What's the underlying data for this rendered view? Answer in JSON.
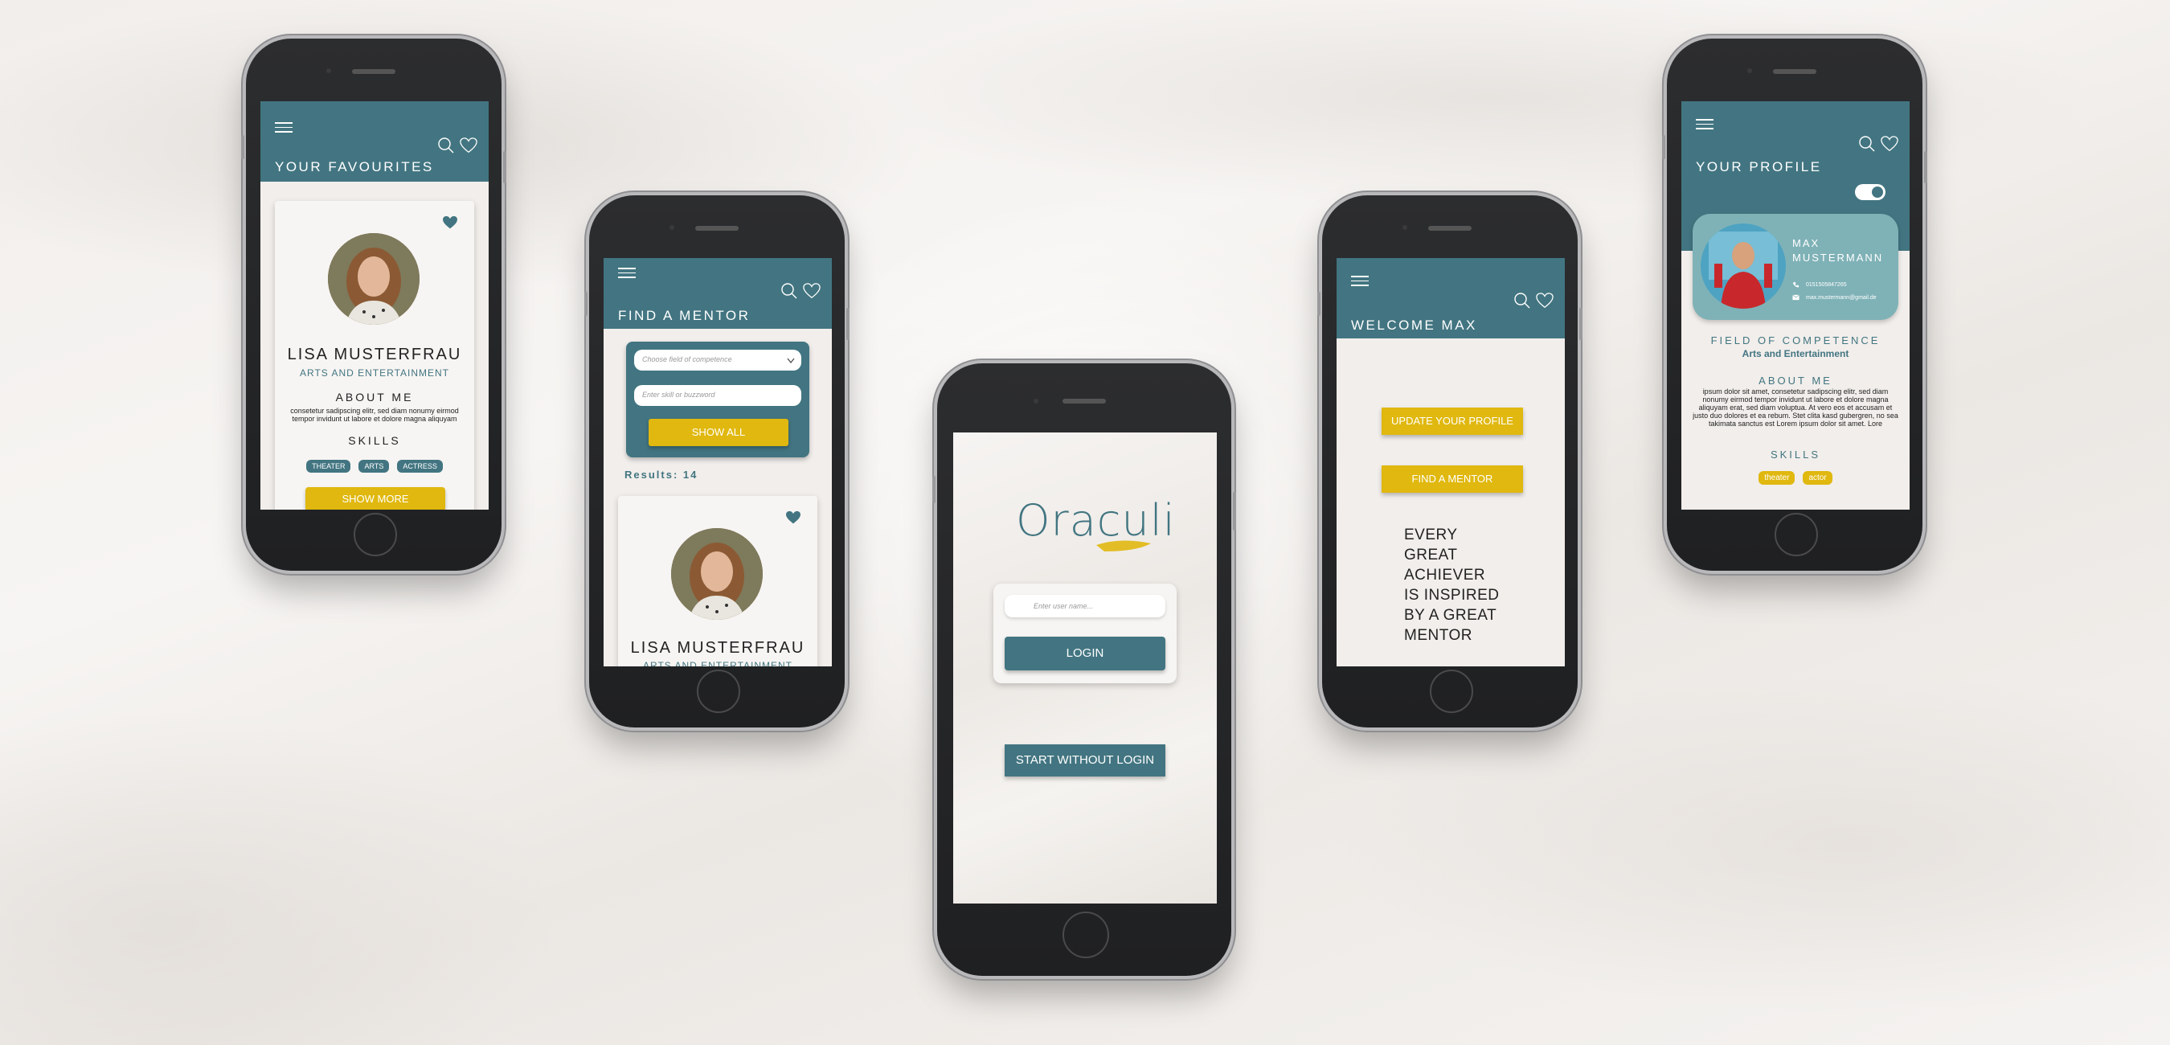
{
  "phone_favourites": {
    "title": "YOUR FAVOURITES",
    "name": "LISA MUSTERFRAU",
    "field": "ARTS AND ENTERTAINMENT",
    "about_heading": "ABOUT ME",
    "about_text": "consetetur sadipscing elitr, sed diam nonumy eirmod tempor invidunt ut labore et dolore magna aliquyam erat, sed diam voluptua. At vero eos et",
    "skills_heading": "SKILLS",
    "skills": [
      "THEATER",
      "ARTS",
      "ACTRESS"
    ],
    "show_more": "SHOW MORE"
  },
  "phone_find_mentor": {
    "title": "FIND A MENTOR",
    "select_placeholder": "Choose field of competence",
    "search_placeholder": "Enter skill or buzzword",
    "show_all": "SHOW ALL",
    "results": "Results: 14",
    "name": "LISA MUSTERFRAU",
    "field": "ARTS AND ENTERTAINMENT"
  },
  "phone_login": {
    "logo": "Oraculi",
    "username_placeholder": "Enter user name...",
    "login": "LOGIN",
    "start_without_login": "START WITHOUT LOGIN"
  },
  "phone_welcome": {
    "title": "WELCOME MAX",
    "update_profile": "UPDATE YOUR PROFILE",
    "find_mentor": "FIND A MENTOR",
    "quote": [
      "EVERY",
      "GREAT",
      "ACHIEVER",
      "IS INSPIRED",
      "BY A GREAT",
      "MENTOR"
    ]
  },
  "phone_profile": {
    "title": "YOUR PROFILE",
    "name_line1": "MAX",
    "name_line2": "MUSTERMANN",
    "phone": "0151505847265",
    "email": "max.mustermann@gmail.de",
    "competence_heading": "FIELD OF COMPETENCE",
    "competence": "Arts and Entertainment",
    "about_heading": "ABOUT ME",
    "about_text": "ipsum dolor sit amet, consetetur sadipscing elitr, sed diam nonumy eirmod tempor invidunt ut labore et dolore magna aliquyam erat, sed diam voluptua. At vero eos et accusam et justo duo dolores et ea rebum. Stet clita kasd gubergren, no sea takimata sanctus est Lorem ipsum dolor sit amet. Lore",
    "skills_heading": "SKILLS",
    "skills": [
      "theater",
      "actor"
    ]
  },
  "colors": {
    "teal": "#427581",
    "yellow": "#e0b80f",
    "light_teal": "#7fb2b7"
  }
}
